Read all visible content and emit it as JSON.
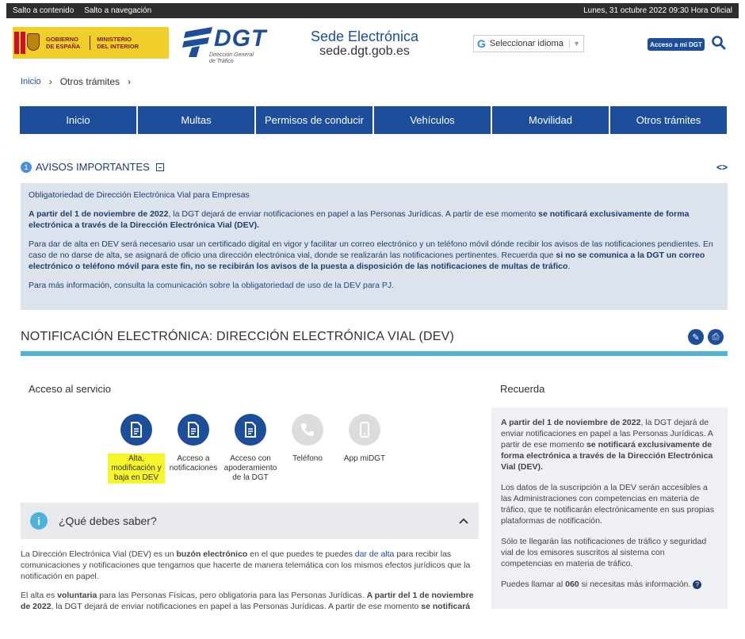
{
  "topbar": {
    "skip_content": "Salto a contenido",
    "skip_nav": "Salto a navegación",
    "datetime": "Lunes, 31 octubre 2022 09:30 Hora Oficial"
  },
  "header": {
    "gov_line1": "GOBIERNO",
    "gov_line2": "DE ESPAÑA",
    "ministry_line1": "MINISTERIO",
    "ministry_line2": "DEL INTERIOR",
    "dgt_word": "DGT",
    "dgt_sub1": "Dirección General",
    "dgt_sub2": "de Tráfico",
    "sede_title": "Sede Electrónica",
    "sede_url": "sede.dgt.gob.es",
    "translate_label": "Seleccionar idioma",
    "translate_icon": "google-g-icon",
    "access_button": "Acceso a mi DGT",
    "search_icon": "search-icon"
  },
  "breadcrumb": {
    "home": "Inicio",
    "current": "Otros trámites"
  },
  "nav": {
    "items": [
      "Inicio",
      "Multas",
      "Permisos de conducir",
      "Vehículos",
      "Movilidad",
      "Otros trámites"
    ]
  },
  "avisos": {
    "count": "1",
    "title": "AVISOS IMPORTANTES",
    "arrows": "<>",
    "heading": "Obligatoriedad de Dirección Electrónica Vial para Empresas",
    "p1_b1": "A partir del 1 de noviembre de 2022",
    "p1_t1": ", la DGT dejará de enviar notificaciones en papel a las Personas Jurídicas. A partir de ese momento ",
    "p1_b2": "se notificará exclusivamente de forma electrónica a través de la Dirección Electrónica Vial (DEV).",
    "p2_t1": "Para dar de alta en DEV será necesario usar un certificado digital en vigor y facilitar un correo electrónico y un teléfono móvil dónde recibir los avisos de las notificaciones pendientes. En caso de no darse de alta, se asignará de oficio una dirección electrónica vial, donde se realizarán las notificaciones pertinentes. Recuerda que ",
    "p2_b1": "si no se comunica a la DGT un correo electrónico o teléfono móvil para este fin, no se recibirán los avisos de la puesta a disposición de las notificaciones de multas de tráfico",
    "p2_t2": ".",
    "p3_t1": "Para más información, ",
    "p3_link": "consulta la comunicación sobre la obligatoriedad de uso de la DEV para PJ",
    "p3_t2": "."
  },
  "section": {
    "title": "NOTIFICACIÓN ELECTRÓNICA: DIRECCIÓN ELECTRÓNICA VIAL (DEV)",
    "icon_left": "pen-icon",
    "icon_right": "print-icon"
  },
  "acceso": {
    "title": "Acceso al servicio",
    "services": [
      {
        "label": "Alta, modificación y baja en DEV",
        "icon": "document-icon",
        "enabled": true,
        "highlighted": true
      },
      {
        "label": "Acceso a notificaciones",
        "icon": "document-icon",
        "enabled": true,
        "highlighted": false
      },
      {
        "label": "Acceso con apoderamiento de la DGT",
        "icon": "document-icon",
        "enabled": true,
        "highlighted": false
      },
      {
        "label": "Teléfono",
        "icon": "phone-icon",
        "enabled": false,
        "highlighted": false
      },
      {
        "label": "App miDGT",
        "icon": "mobile-icon",
        "enabled": false,
        "highlighted": false
      }
    ]
  },
  "recuerda": {
    "title": "Recuerda",
    "p1_b1": "A partir del 1 de noviembre de 2022",
    "p1_t1": ", la DGT dejará de enviar notificaciones en papel a las Personas Jurídicas. A partir de ese momento ",
    "p1_b2": "se notificará exclusivamente de forma electrónica a través de la Dirección Electrónica Vial (DEV).",
    "p2": "Los datos de la suscripción a la DEV serán accesibles a las Administraciones con competencias en materia de tráfico, que te notificarán electrónicamente en sus propias plataformas de notificación.",
    "p3": "Sólo te llegarán las notificaciones de tráfico y seguridad vial de los emisores suscritos al sistema con competencias en materia de tráfico.",
    "p4_t1": "Puedes llamar al ",
    "p4_b1": "060",
    "p4_t2": " si necesitas más información.",
    "help_icon": "question-icon"
  },
  "qds": {
    "label": "¿Qué debes saber?",
    "info_icon": "info-icon",
    "chevron_icon": "chevron-up-icon"
  },
  "body": {
    "p1_t1": "La Dirección Electrónica Vial (DEV) es un ",
    "p1_b1": "buzón electrónico",
    "p1_t2": " en el que puedes te puedes ",
    "p1_link": "dar de alta",
    "p1_t3": " para recibir las comunicaciones y notificaciones que tengamos que hacerte de manera telemática con los mismos efectos jurídicos que la notificación en papel.",
    "p2_t1": "El alta es ",
    "p2_b1": "voluntaria",
    "p2_t2": " para las Personas Físicas, pero obligatoria para las Personas Jurídicas. ",
    "p2_b2": "A partir del 1 de noviembre de 2022",
    "p2_t3": ", la DGT dejará de enviar notificaciones en papel a las Personas Jurídicas. A partir de ese momento ",
    "p2_b3": "se notificará"
  }
}
